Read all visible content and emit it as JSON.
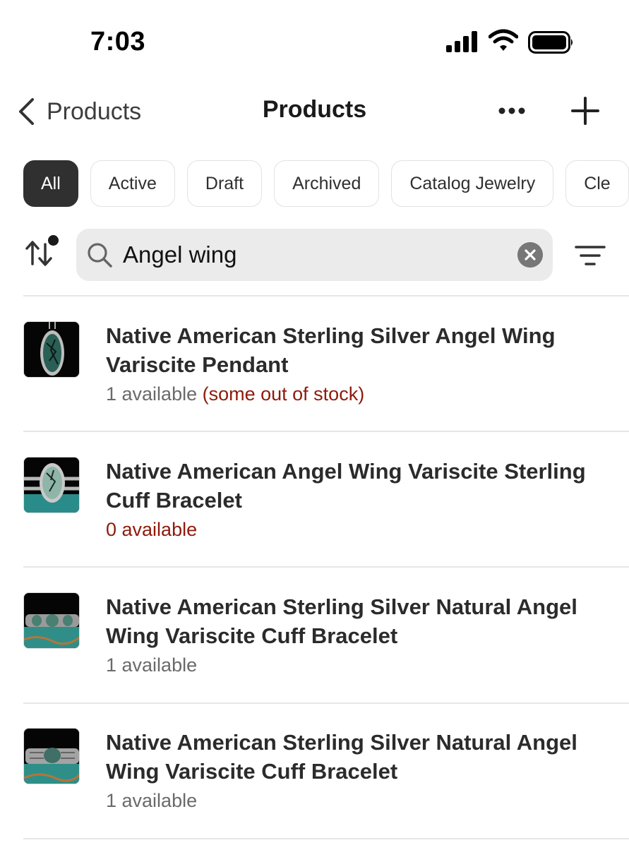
{
  "status_bar": {
    "time": "7:03"
  },
  "nav": {
    "back_label": "Products",
    "title": "Products"
  },
  "tabs": [
    {
      "label": "All",
      "active": true
    },
    {
      "label": "Active",
      "active": false
    },
    {
      "label": "Draft",
      "active": false
    },
    {
      "label": "Archived",
      "active": false
    },
    {
      "label": "Catalog Jewelry",
      "active": false
    },
    {
      "label": "Cle",
      "active": false
    }
  ],
  "search": {
    "value": "Angel wing"
  },
  "products": [
    {
      "title": "Native American Sterling Silver Angel Wing Variscite Pendant",
      "available": "1 available",
      "stock_note": "(some out of stock)"
    },
    {
      "title": "Native American Angel Wing Variscite Sterling Cuff Bracelet",
      "available": "0 available",
      "stock_note": ""
    },
    {
      "title": "Native American Sterling Silver Natural Angel Wing Variscite Cuff Bracelet",
      "available": "1 available",
      "stock_note": ""
    },
    {
      "title": "Native American Sterling Silver Natural Angel Wing Variscite Cuff Bracelet",
      "available": "1 available",
      "stock_note": ""
    }
  ],
  "colors": {
    "accent_dark": "#303030",
    "warning_text": "#8e1b0d",
    "muted_text": "#6a6a6a",
    "search_bg": "#ebebeb"
  }
}
